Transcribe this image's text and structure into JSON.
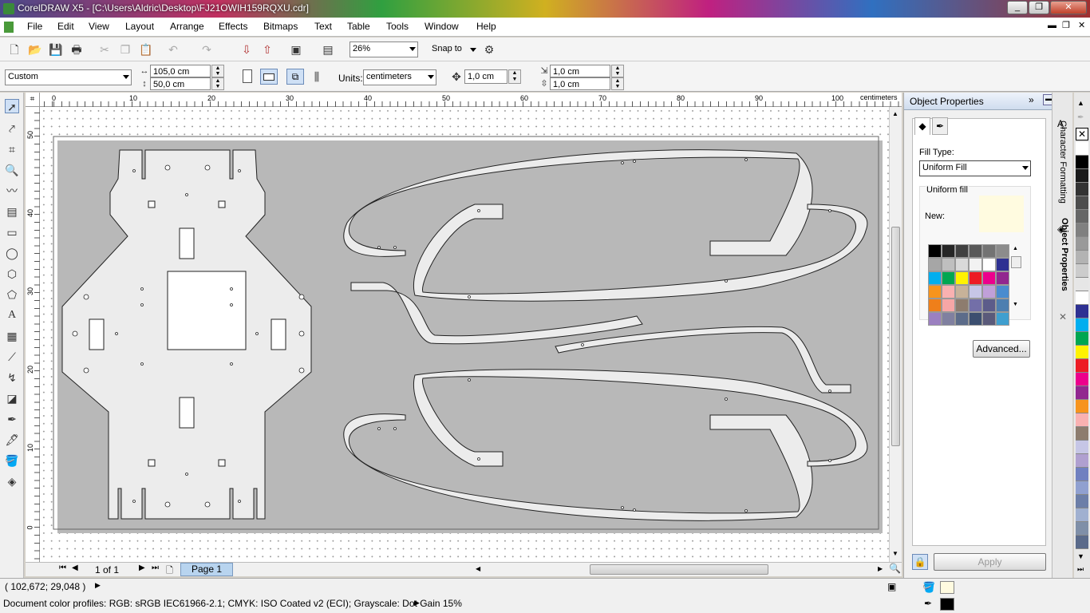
{
  "window": {
    "title": "CorelDRAW X5 - [C:\\Users\\Aldric\\Desktop\\FJ21OWIH159RQXU.cdr]"
  },
  "menu": [
    "File",
    "Edit",
    "View",
    "Layout",
    "Arrange",
    "Effects",
    "Bitmaps",
    "Text",
    "Table",
    "Tools",
    "Window",
    "Help"
  ],
  "toolbar": {
    "zoom": "26%",
    "snap_to": "Snap to"
  },
  "property_bar": {
    "page_size": "Custom",
    "width": "105,0 cm",
    "height": "50,0 cm",
    "units_label": "Units:",
    "units": "centimeters",
    "nudge": "1,0 cm",
    "dup_x": "1,0 cm",
    "dup_y": "1,0 cm"
  },
  "rulers": {
    "unit": "centimeters",
    "top_ticks": [
      "0",
      "10",
      "20",
      "30",
      "40",
      "50",
      "60",
      "70",
      "80",
      "90",
      "100"
    ],
    "left_ticks": [
      "50",
      "40",
      "30",
      "20",
      "10",
      "0"
    ]
  },
  "page_nav": {
    "count": "1 of 1",
    "tab": "Page 1"
  },
  "docker": {
    "title": "Object Properties",
    "fill_type_label": "Fill Type:",
    "fill_type": "Uniform Fill",
    "uniform_fill_label": "Uniform fill",
    "new_label": "New:",
    "new_color": "#fffbe0",
    "advanced": "Advanced...",
    "apply": "Apply",
    "swatches": [
      "#000000",
      "#262626",
      "#404040",
      "#595959",
      "#737373",
      "#8c8c8c",
      "#a6a6a6",
      "#bfbfbf",
      "#d9d9d9",
      "#f2f2f2",
      "#ffffff",
      "#2e3192",
      "#00aeef",
      "#00a651",
      "#fff200",
      "#ed1c24",
      "#ec008c",
      "#92278f",
      "#f7941d",
      "#f9b1b1",
      "#c7b299",
      "#c6c6e6",
      "#c0a0d8",
      "#4a8ccf",
      "#ef7f1a",
      "#f6a6a6",
      "#8d7c6e",
      "#736fa8",
      "#5c5c8a",
      "#4d7fb0",
      "#9b80c0",
      "#8080a0",
      "#5c6c8a",
      "#3c4f70",
      "#5a5a7a",
      "#3f9fcf"
    ]
  },
  "docker_tabs": [
    "Character Formatting",
    "Object Properties"
  ],
  "palette": [
    "#ffffff",
    "#000000",
    "#1a1a1a",
    "#333333",
    "#4d4d4d",
    "#666666",
    "#808080",
    "#999999",
    "#b3b3b3",
    "#cccccc",
    "#e6e6e6",
    "#ffffff",
    "#2e3192",
    "#00aeef",
    "#00a651",
    "#fff200",
    "#ed1c24",
    "#ec008c",
    "#92278f",
    "#f7941d",
    "#f9b1b1",
    "#8d7c6e",
    "#c6c6e6",
    "#b0a0d0",
    "#7080c0",
    "#90a0d0",
    "#6c7ea8",
    "#a0b0d0",
    "#7f8fa8",
    "#5a6a8a"
  ],
  "status": {
    "coords": "( 102,672; 29,048 )",
    "profiles": "Document color profiles: RGB: sRGB IEC61966-2.1; CMYK: ISO Coated v2 (ECI); Grayscale: Dot Gain 15%",
    "fill_color": "#fffbe0",
    "outline_color": "#000000"
  }
}
